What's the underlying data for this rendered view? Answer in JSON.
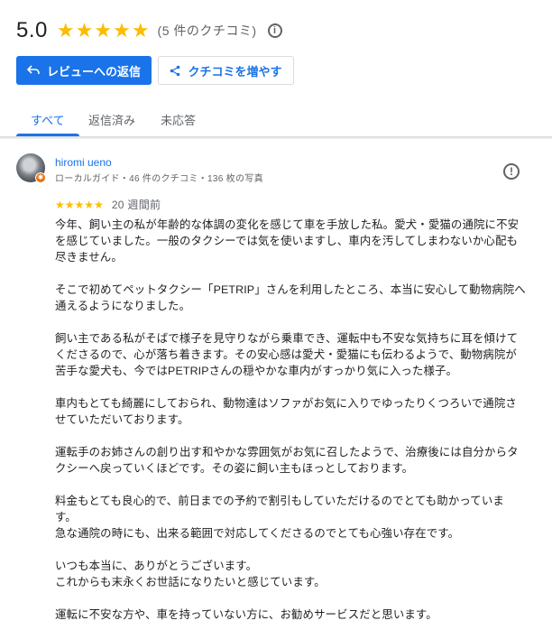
{
  "summary": {
    "rating": "5.0",
    "stars": [
      "★",
      "★",
      "★",
      "★",
      "★"
    ],
    "count_label": "(5 件のクチコミ)"
  },
  "buttons": {
    "reply_label": "レビューへの返信",
    "more_reviews_label": "クチコミを増やす"
  },
  "tabs": [
    {
      "label": "すべて",
      "active": true
    },
    {
      "label": "返信済み",
      "active": false
    },
    {
      "label": "未応答",
      "active": false
    }
  ],
  "review": {
    "author": "hiromi ueno",
    "meta": "ローカルガイド・46 件のクチコミ・136 枚の写真",
    "stars": [
      "★",
      "★",
      "★",
      "★",
      "★"
    ],
    "time": "20 週間前",
    "paragraphs": [
      "今年、飼い主の私が年齢的な体調の変化を感じて車を手放した私。愛犬・愛猫の通院に不安\nを感じていました。一般のタクシーでは気を使いますし、車内を汚してしまわないか心配も\n尽きません。",
      "そこで初めてペットタクシー「PETRIP」さんを利用したところ、本当に安心して動物病院へ\n通えるようになりました。",
      "飼い主である私がそばで様子を見守りながら乗車でき、運転中も不安な気持ちに耳を傾けて\nくださるので、心が落ち着きます。その安心感は愛犬・愛猫にも伝わるようで、動物病院が\n苦手な愛犬も、今ではPETRIPさんの穏やかな車内がすっかり気に入った様子。",
      "車内もとても綺麗にしておられ、動物達はソファがお気に入りでゆったりくつろいで通院さ\nせていただいております。",
      "運転手のお姉さんの創り出す和やかな雰囲気がお気に召したようで、治療後には自分からタ\nクシーへ戻っていくほどです。その姿に飼い主もほっとしております。",
      "料金もとても良心的で、前日までの予約で割引もしていただけるのでとても助かっていま\nす。\n急な通院の時にも、出来る範囲で対応してくださるのでとても心強い存在です。",
      "いつも本当に、ありがとうございます。\nこれからも末永くお世話になりたいと感じています。",
      "運転に不安な方や、車を持っていない方に、お勧めサービスだと思います。"
    ]
  },
  "colors": {
    "accent": "#1a73e8",
    "star": "#fbbc04",
    "badge": "#e8710a"
  },
  "icons": {
    "info": "info-icon",
    "reply": "reply-icon",
    "share": "share-icon",
    "flag": "flag-icon"
  }
}
